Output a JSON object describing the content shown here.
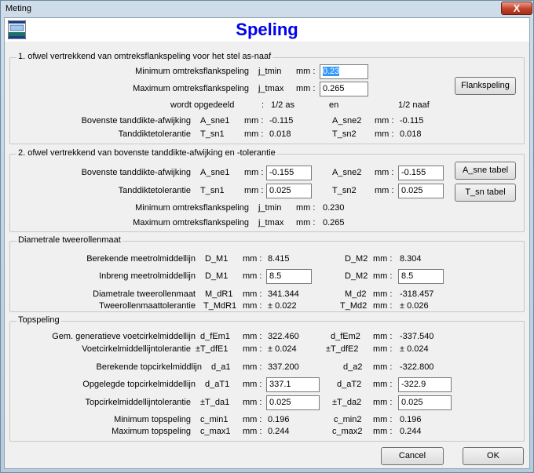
{
  "window": {
    "title": "Meting",
    "close_glyph": "X"
  },
  "header": {
    "heading": "Speling",
    "logo": "app-logo-icon"
  },
  "group1": {
    "title": "1. ofwel vertrekkend van omtreksflankspeling voor het stel as-naaf",
    "min_label": "Minimum omtreksflankspeling",
    "min_sym": "j_tmin",
    "min_unit": "mm :",
    "min_value": "0.23",
    "max_label": "Maximum omtreksflankspeling",
    "max_sym": "j_tmax",
    "max_unit": "mm :",
    "max_value": "0.265",
    "button": "Flankspeling",
    "split_label": "wordt opgedeeld",
    "split_colon": ":",
    "split_as": "1/2 as",
    "split_en": "en",
    "split_naaf": "1/2 naaf",
    "row3_label": "Bovenste tanddikte-afwijking",
    "row3_sym1": "A_sne1",
    "row3_unit1": "mm :",
    "row3_val1": "-0.115",
    "row3_sym2": "A_sne2",
    "row3_unit2": "mm :",
    "row3_val2": "-0.115",
    "row4_label": "Tanddiktetolerantie",
    "row4_sym1": "T_sn1",
    "row4_unit1": "mm :",
    "row4_val1": "0.018",
    "row4_sym2": "T_sn2",
    "row4_unit2": "mm :",
    "row4_val2": "0.018"
  },
  "group2": {
    "title": "2. ofwel vertrekkend van bovenste tanddikte-afwijking en -tolerantie",
    "r1_label": "Bovenste tanddikte-afwijking",
    "r1_sym1": "A_sne1",
    "r1_unit1": "mm :",
    "r1_val1": "-0.155",
    "r1_sym2": "A_sne2",
    "r1_unit2": "mm :",
    "r1_val2": "-0.155",
    "btn1": "A_sne tabel",
    "r2_label": "Tanddiktetolerantie",
    "r2_sym1": "T_sn1",
    "r2_unit1": "mm :",
    "r2_val1": "0.025",
    "r2_sym2": "T_sn2",
    "r2_unit2": "mm :",
    "r2_val2": "0.025",
    "btn2": "T_sn tabel",
    "r3_label": "Minimum omtreksflankspeling",
    "r3_sym": "j_tmin",
    "r3_unit": "mm :",
    "r3_val": "0.230",
    "r4_label": "Maximum omtreksflankspeling",
    "r4_sym": "j_tmax",
    "r4_unit": "mm :",
    "r4_val": "0.265"
  },
  "group3": {
    "title": "Diametrale tweerollenmaat",
    "r1_label": "Berekende meetrolmiddellijn",
    "r1_sym1": "D_M1",
    "r1_unit1": "mm :",
    "r1_val1": "8.415",
    "r1_sym2": "D_M2",
    "r1_unit2": "mm :",
    "r1_val2": "8.304",
    "r2_label": "Inbreng meetrolmiddellijn",
    "r2_sym1": "D_M1",
    "r2_unit1": "mm :",
    "r2_val1": "8.5",
    "r2_sym2": "D_M2",
    "r2_unit2": "mm :",
    "r2_val2": "8.5",
    "r3_label": "Diametrale tweerollenmaat",
    "r3_sym1": "M_dR1",
    "r3_unit1": "mm :",
    "r3_val1": "341.344",
    "r3_sym2": "M_d2",
    "r3_unit2": "mm :",
    "r3_val2": "-318.457",
    "r4_label": "Tweerollenmaattolerantie",
    "r4_sym1": "T_MdR1",
    "r4_unit1": "mm :",
    "r4_val1": "± 0.022",
    "r4_sym2": "T_Md2",
    "r4_unit2": "mm :",
    "r4_val2": "± 0.026"
  },
  "group4": {
    "title": "Topspeling",
    "r1_label": "Gem. generatieve voetcirkelmiddellijn",
    "r1_sym1": "d_fEm1",
    "r1_unit1": "mm :",
    "r1_val1": "322.460",
    "r1_sym2": "d_fEm2",
    "r1_unit2": "mm :",
    "r1_val2": "-337.540",
    "r2_label": "Voetcirkelmiddellijntolerantie",
    "r2_sym1": "±T_dfE1",
    "r2_unit1": "mm :",
    "r2_val1": "± 0.024",
    "r2_sym2": "±T_dfE2",
    "r2_unit2": "mm :",
    "r2_val2": "± 0.024",
    "r3_label": "Berekende topcirkelmiddlijn",
    "r3_sym1": "d_a1",
    "r3_unit1": "mm :",
    "r3_val1": "337.200",
    "r3_sym2": "d_a2",
    "r3_unit2": "mm :",
    "r3_val2": "-322.800",
    "r4_label": "Opgelegde topcirkelmiddellijn",
    "r4_sym1": "d_aT1",
    "r4_unit1": "mm :",
    "r4_val1": "337.1",
    "r4_sym2": "d_aT2",
    "r4_unit2": "mm :",
    "r4_val2": "-322.9",
    "r5_label": "Topcirkelmiddellijntolerantie",
    "r5_sym1": "±T_da1",
    "r5_unit1": "mm :",
    "r5_val1": "0.025",
    "r5_sym2": "±T_da2",
    "r5_unit2": "mm :",
    "r5_val2": "0.025",
    "r6_label": "Minimum topspeling",
    "r6_sym1": "c_min1",
    "r6_unit1": "mm :",
    "r6_val1": "0.196",
    "r6_sym2": "c_min2",
    "r6_unit2": "mm :",
    "r6_val2": "0.196",
    "r7_label": "Maximum topspeling",
    "r7_sym1": "c_max1",
    "r7_unit1": "mm :",
    "r7_val1": "0.244",
    "r7_sym2": "c_max2",
    "r7_unit2": "mm :",
    "r7_val2": "0.244"
  },
  "footer": {
    "cancel": "Cancel",
    "ok": "OK"
  }
}
